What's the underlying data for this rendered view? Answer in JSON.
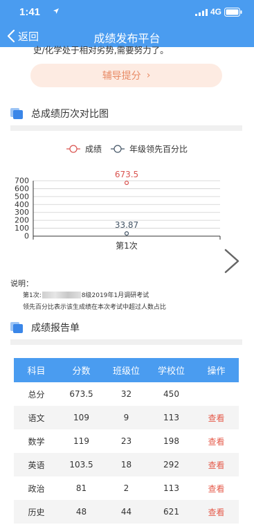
{
  "status_bar": {
    "time": "1:41",
    "network": "4G"
  },
  "nav": {
    "back_label": "返回",
    "title": "成绩发布平台"
  },
  "partial_text": "史/化学处于相对劣势,需要努力了。",
  "tutor_button": {
    "label": "辅导提分"
  },
  "history_section": {
    "title": "总成绩历次对比图"
  },
  "chart_data": {
    "type": "line",
    "categories": [
      "第1次"
    ],
    "series": [
      {
        "name": "成绩",
        "values": [
          673.5
        ],
        "color": "#d9534f",
        "label": "673.5"
      },
      {
        "name": "年级领先百分比",
        "values": [
          33.87
        ],
        "color": "#445566",
        "label": "33.87"
      }
    ],
    "ylim": [
      0,
      700
    ],
    "yticks": [
      "0",
      "100",
      "200",
      "300",
      "400",
      "500",
      "600",
      "700"
    ],
    "legend_position": "top-center",
    "grid": true
  },
  "note": {
    "title": "说明：",
    "line1_prefix": "第1次:",
    "line1_suffix": "8级2019年1月调研考试",
    "line2": "领先百分比表示该生成绩在本次考试中超过人数占比"
  },
  "report_section": {
    "title": "成绩报告单"
  },
  "table": {
    "headers": [
      "科目",
      "分数",
      "班级位",
      "学校位",
      "操作"
    ],
    "rows": [
      {
        "subject": "总分",
        "score": "673.5",
        "class_rank": "32",
        "school_rank": "450",
        "action": ""
      },
      {
        "subject": "语文",
        "score": "109",
        "class_rank": "9",
        "school_rank": "113",
        "action": "查看"
      },
      {
        "subject": "数学",
        "score": "119",
        "class_rank": "23",
        "school_rank": "198",
        "action": "查看"
      },
      {
        "subject": "英语",
        "score": "103.5",
        "class_rank": "18",
        "school_rank": "292",
        "action": "查看"
      },
      {
        "subject": "政治",
        "score": "81",
        "class_rank": "2",
        "school_rank": "113",
        "action": "查看"
      },
      {
        "subject": "历史",
        "score": "48",
        "class_rank": "44",
        "school_rank": "621",
        "action": "查看"
      }
    ]
  },
  "colors": {
    "primary": "#4a9cf0",
    "tutor_bg": "#fdebe2",
    "tutor_text": "#e88a65",
    "link": "#e55b4b"
  }
}
